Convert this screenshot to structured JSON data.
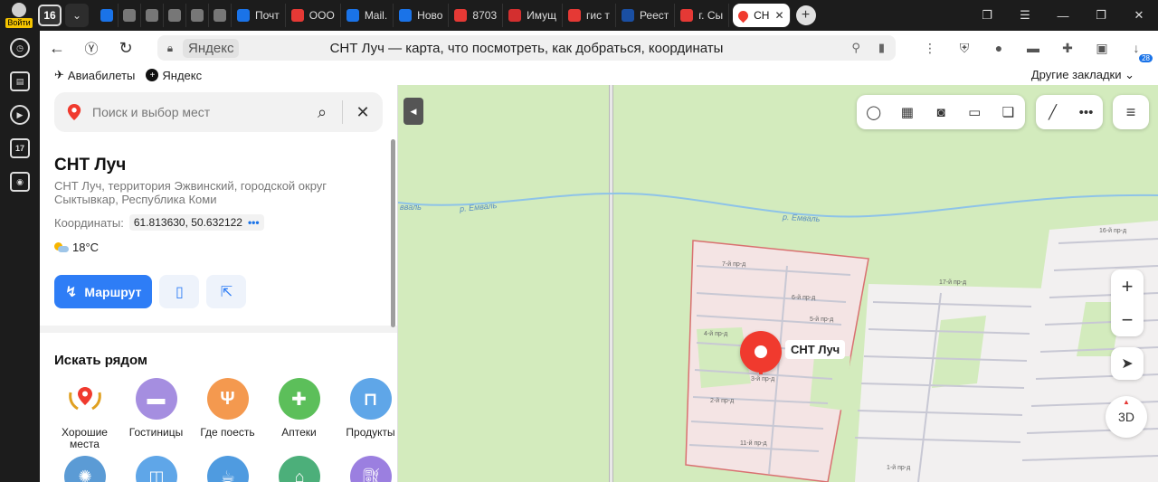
{
  "browser": {
    "login_label": "Войти",
    "tab_count": "16",
    "tabs": [
      {
        "label": "",
        "color": "#1a73e8",
        "icon": "cloud"
      },
      {
        "label": "",
        "color": "#777777",
        "icon": "doc"
      },
      {
        "label": "",
        "color": "#777777",
        "icon": "doc"
      },
      {
        "label": "",
        "color": "#777777",
        "icon": "doc"
      },
      {
        "label": "",
        "color": "#777777",
        "icon": "doc"
      },
      {
        "label": "",
        "color": "#777777",
        "icon": "doc"
      },
      {
        "label": "Почт",
        "color": "#1a73e8",
        "icon": "mail"
      },
      {
        "label": "ООО",
        "color": "#e53935",
        "icon": "pdf"
      },
      {
        "label": "Mail.",
        "color": "#1a73e8",
        "icon": "at"
      },
      {
        "label": "Ново",
        "color": "#1a73e8",
        "icon": "at"
      },
      {
        "label": "8703",
        "color": "#e53935",
        "icon": "pdf"
      },
      {
        "label": "Имущ",
        "color": "#d32f2f",
        "icon": "rts"
      },
      {
        "label": "гис т",
        "color": "#e53935",
        "icon": "yandex"
      },
      {
        "label": "Реест",
        "color": "#1a4fa3",
        "icon": "eagle"
      },
      {
        "label": "г. Сы",
        "color": "#e53935",
        "icon": "yandex"
      }
    ],
    "active_tab": {
      "label": "СН",
      "color": "#f03a2e"
    },
    "url_domain": "Яндекс",
    "page_title": "СНТ Луч — карта, что посмотреть, как добраться, координаты",
    "bookmarks": [
      {
        "label": "Авиабилеты",
        "icon": "plane"
      },
      {
        "label": "Яндекс",
        "icon": "yandex"
      }
    ],
    "other_bookmarks": "Другие закладки",
    "extension_badge": "28"
  },
  "sidebar_icons": [
    "history-icon",
    "collections-icon",
    "video-icon",
    "calendar-icon",
    "screenshot-icon"
  ],
  "calendar_day": "17",
  "panel": {
    "search_placeholder": "Поиск и выбор мест",
    "place_name": "СНТ Луч",
    "address": "СНТ Луч, территория Эжвинский, городской округ Сыктывкар, Республика Коми",
    "coords_label": "Координаты:",
    "coords_value": "61.813630, 50.632122",
    "weather": "18°C",
    "route_label": "Маршрут",
    "nearby_title": "Искать рядом",
    "categories": [
      {
        "label": "Хорошие места",
        "color": "#ffffff"
      },
      {
        "label": "Гостиницы",
        "color": "#a58ee0"
      },
      {
        "label": "Где поесть",
        "color": "#f4994f"
      },
      {
        "label": "Аптеки",
        "color": "#5cbf5a"
      },
      {
        "label": "Продукты",
        "color": "#5fa6e8"
      }
    ],
    "categories_row2_colors": [
      "#5b9bd5",
      "#5fa6e8",
      "#4f9be0",
      "#4caf7a",
      "#9b7fe0"
    ]
  },
  "map": {
    "marker_label": "СНТ Луч",
    "river_labels": [
      "р. Емваль",
      "р. Емваль",
      "вваль"
    ],
    "btn_3d": "3D",
    "zoom_in": "+",
    "zoom_out": "−",
    "streets": [
      "7-й пр-д",
      "6-й пр-д",
      "5-й пр-д",
      "4-й пр-д",
      "3-й пр-д",
      "2-й пр-д",
      "11-й пр-д",
      "17-й пр-д",
      "16-й пр-д",
      "1-й пр-д"
    ]
  }
}
